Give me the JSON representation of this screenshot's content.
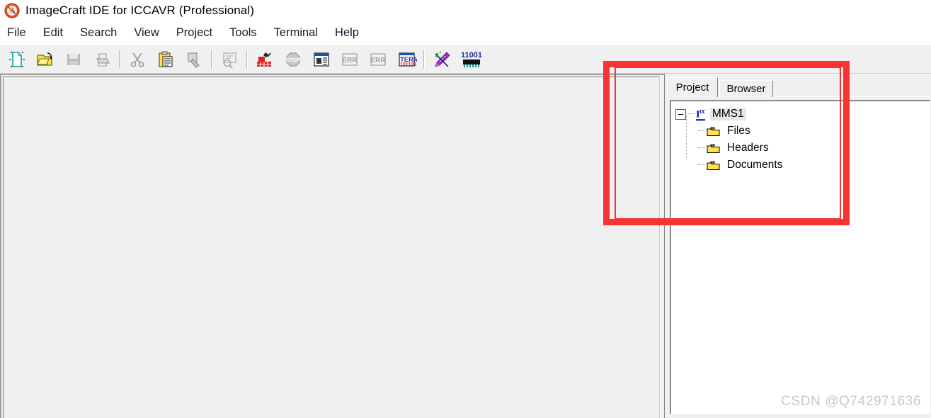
{
  "window": {
    "title": "ImageCraft IDE for ICCAVR (Professional)",
    "logo_icon": "imagecraft-logo-icon"
  },
  "menubar": {
    "items": [
      {
        "label": "File"
      },
      {
        "label": "Edit"
      },
      {
        "label": "Search"
      },
      {
        "label": "View"
      },
      {
        "label": "Project"
      },
      {
        "label": "Tools"
      },
      {
        "label": "Terminal"
      },
      {
        "label": "Help"
      }
    ]
  },
  "toolbar": {
    "groups": [
      {
        "buttons": [
          {
            "icon": "new-file-icon",
            "enabled": true
          },
          {
            "icon": "open-folder-icon",
            "enabled": true
          },
          {
            "icon": "save-icon",
            "enabled": false
          },
          {
            "icon": "print-icon",
            "enabled": false
          }
        ]
      },
      {
        "buttons": [
          {
            "icon": "cut-scissors-icon",
            "enabled": false
          },
          {
            "icon": "paste-clipboard-icon",
            "enabled": true
          },
          {
            "icon": "copy-stamp-icon",
            "enabled": false
          }
        ]
      },
      {
        "buttons": [
          {
            "icon": "find-in-files-icon",
            "enabled": false
          }
        ]
      },
      {
        "buttons": [
          {
            "icon": "build-project-icon",
            "enabled": true
          },
          {
            "icon": "stop-build-icon",
            "enabled": false
          },
          {
            "icon": "project-settings-icon",
            "enabled": true
          },
          {
            "icon": "next-error-icon",
            "enabled": false
          },
          {
            "icon": "previous-error-icon",
            "enabled": false
          },
          {
            "icon": "terminal-icon",
            "enabled": true
          }
        ]
      },
      {
        "buttons": [
          {
            "icon": "application-builder-wizard-icon",
            "enabled": true
          },
          {
            "icon": "chip-programmer-icon",
            "enabled": true,
            "label": "11001"
          }
        ]
      }
    ]
  },
  "project_panel": {
    "tabs": [
      {
        "label": "Project",
        "active": true
      },
      {
        "label": "Browser",
        "active": false
      }
    ],
    "tree": {
      "root": {
        "label": "MMS1",
        "icon": "icc-project-icon",
        "expander": "minus-expander-icon",
        "expanded": true,
        "selected": true
      },
      "children": [
        {
          "label": "Files",
          "icon": "folder-icon"
        },
        {
          "label": "Headers",
          "icon": "folder-icon"
        },
        {
          "label": "Documents",
          "icon": "folder-icon"
        }
      ]
    }
  },
  "editor": {
    "content": ""
  },
  "annotations": {
    "highlight_color": "#f93232",
    "boxes": [
      {
        "name": "outer-highlight-box"
      },
      {
        "name": "inner-highlight-box"
      }
    ]
  },
  "watermark": {
    "text": "CSDN @Q742971636"
  }
}
